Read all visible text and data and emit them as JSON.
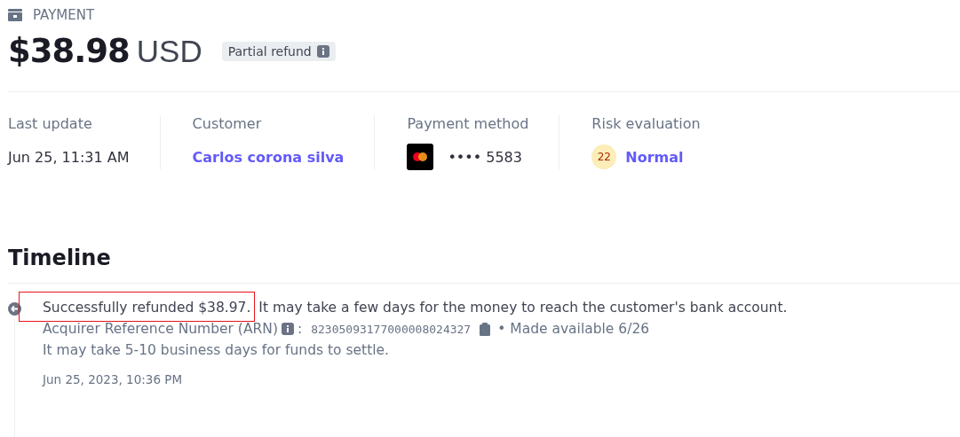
{
  "header": {
    "eyebrow": "PAYMENT",
    "amount": "$38.98",
    "currency": "USD",
    "badge": "Partial refund"
  },
  "summary": [
    {
      "kind": "text",
      "label": "Last update",
      "value": "Jun 25, 11:31 AM"
    },
    {
      "kind": "link",
      "label": "Customer",
      "value": "Carlos corona silva"
    },
    {
      "kind": "card",
      "label": "Payment method",
      "value": "•••• 5583"
    },
    {
      "kind": "risk",
      "label": "Risk evaluation",
      "score": "22",
      "value": "Normal"
    }
  ],
  "timeline": {
    "title": "Timeline",
    "events": [
      {
        "highlighted": "Successfully refunded $38.97.",
        "message": "It may take a few days for the money to reach the customer's bank account.",
        "arn_label": "Acquirer Reference Number (ARN)",
        "arn_sep": ":",
        "arn": "82305093177000008024327",
        "available": "• Made available 6/26",
        "note": "It may take 5-10 business days for funds to settle.",
        "time": "Jun 25, 2023, 10:36 PM"
      }
    ]
  }
}
